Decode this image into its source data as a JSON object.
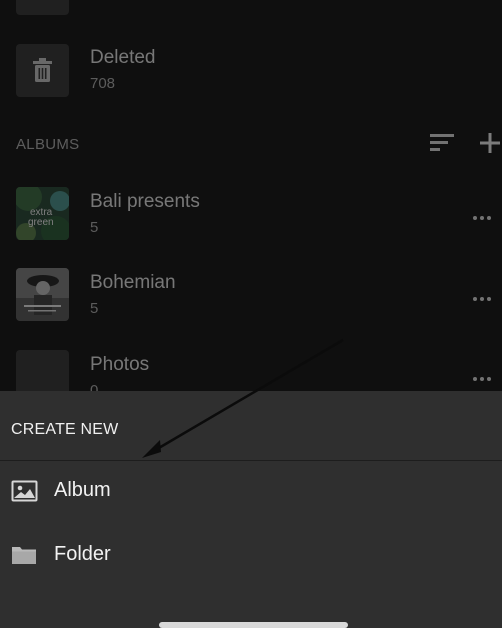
{
  "list": {
    "deleted": {
      "title": "Deleted",
      "count": "708"
    },
    "albums_header": "ALBUMS",
    "albums": [
      {
        "title": "Bali presents",
        "count": "5",
        "thumb_text": "extra green"
      },
      {
        "title": "Bohemian",
        "count": "5"
      },
      {
        "title": "Photos",
        "count": "0"
      }
    ]
  },
  "sheet": {
    "title": "CREATE NEW",
    "items": [
      {
        "label": "Album",
        "icon": "image-icon"
      },
      {
        "label": "Folder",
        "icon": "folder-icon"
      }
    ]
  },
  "colors": {
    "sheet_bg": "#2f2f2f",
    "list_bg": "#1c1c1c",
    "text_primary": "#f2f2f2"
  }
}
